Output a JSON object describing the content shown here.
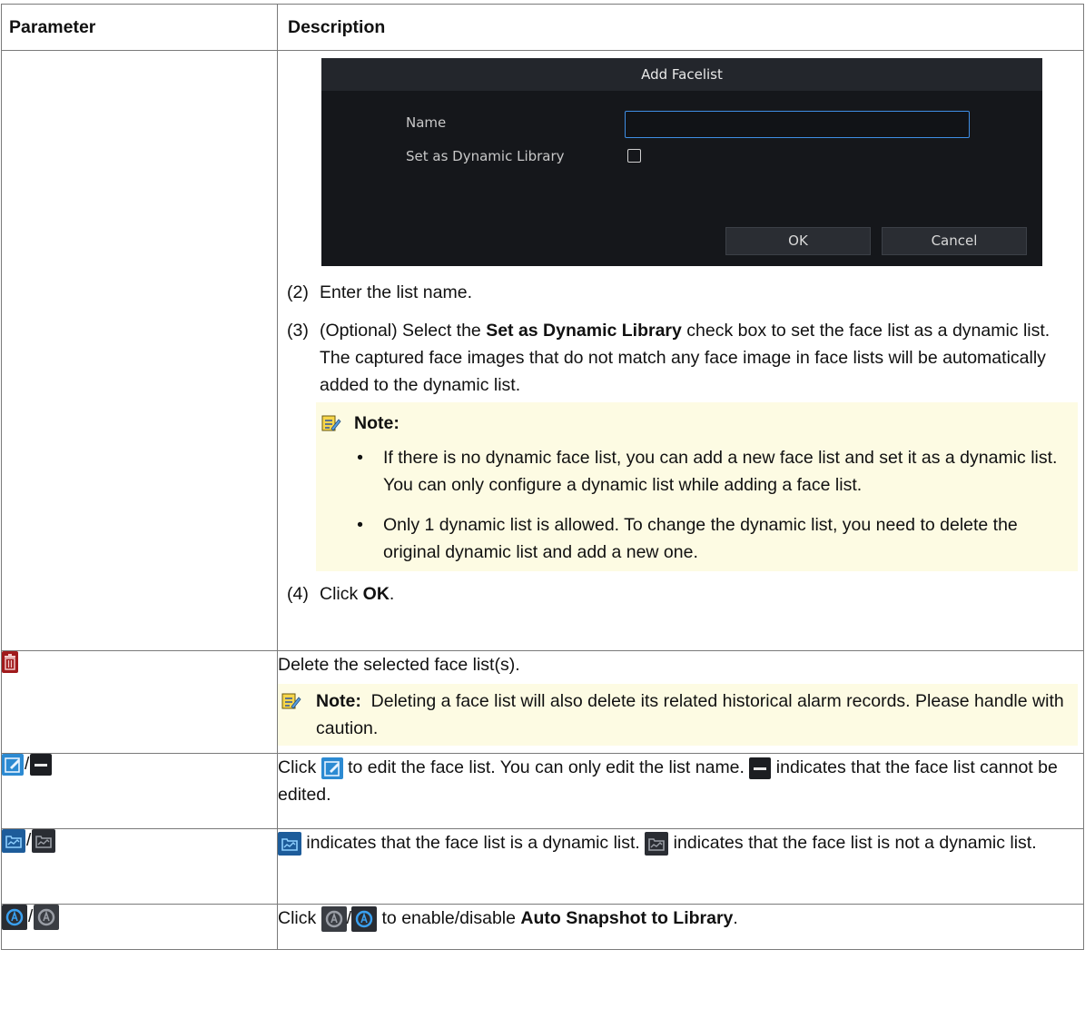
{
  "table": {
    "header": {
      "parameter": "Parameter",
      "description": "Description"
    }
  },
  "dialog": {
    "title": "Add Facelist",
    "name_label": "Name",
    "name_value": "",
    "dynamic_label": "Set as Dynamic Library",
    "dynamic_checked": false,
    "ok_label": "OK",
    "cancel_label": "Cancel"
  },
  "add_row": {
    "step2_num": "(2)",
    "step2_text": "Enter the list name.",
    "step3_num": "(3)",
    "step3_pre": "(Optional) Select the ",
    "step3_bold": "Set as Dynamic Library",
    "step3_post": " check box to set the face list as a dynamic list. The captured face images that do not match any face image in face lists will be automatically added to the dynamic list.",
    "note_label": "Note:",
    "bullet_char": "•",
    "bullet1": "If there is no dynamic face list, you can add a new face list and set it as a dynamic list. You can only configure a dynamic list while adding a face list.",
    "bullet2": "Only 1 dynamic list is allowed. To change the dynamic list, you need to delete the original dynamic list and add a new one.",
    "step4_num": "(4)",
    "step4_pre": "Click ",
    "step4_bold": "OK",
    "step4_post": "."
  },
  "delete_row": {
    "icon": "delete-icon",
    "text": "Delete the selected face list(s).",
    "note_label": "Note:",
    "note_text": "Deleting a face list will also delete its related historical alarm records. Please handle with caution."
  },
  "edit_row": {
    "icons": [
      "edit-icon",
      "non-editable-icon"
    ],
    "slash": "/",
    "t1": "Click ",
    "t2": " to edit the face list. You can only edit the list name. ",
    "t3": " indicates that the face list cannot be edited."
  },
  "dynamic_row": {
    "icons": [
      "dynamic-list-icon",
      "non-dynamic-list-icon"
    ],
    "slash": "/",
    "t1": " indicates that the face list is a dynamic list. ",
    "t2": " indicates that the face list is not a dynamic list."
  },
  "snapshot_row": {
    "icons": [
      "auto-snapshot-enabled-icon",
      "auto-snapshot-disabled-icon"
    ],
    "slash": "/",
    "t1": "Click ",
    "t2": "/",
    "t3": " to enable/disable ",
    "t4": "Auto Snapshot to Library",
    "t5": "."
  },
  "colors": {
    "note_bg": "#fdfbe3",
    "delete_icon": "#a01a1c",
    "edit_icon": "#2c8ad2",
    "dialog_bg": "#15171b",
    "input_border": "#3f8ee4"
  }
}
